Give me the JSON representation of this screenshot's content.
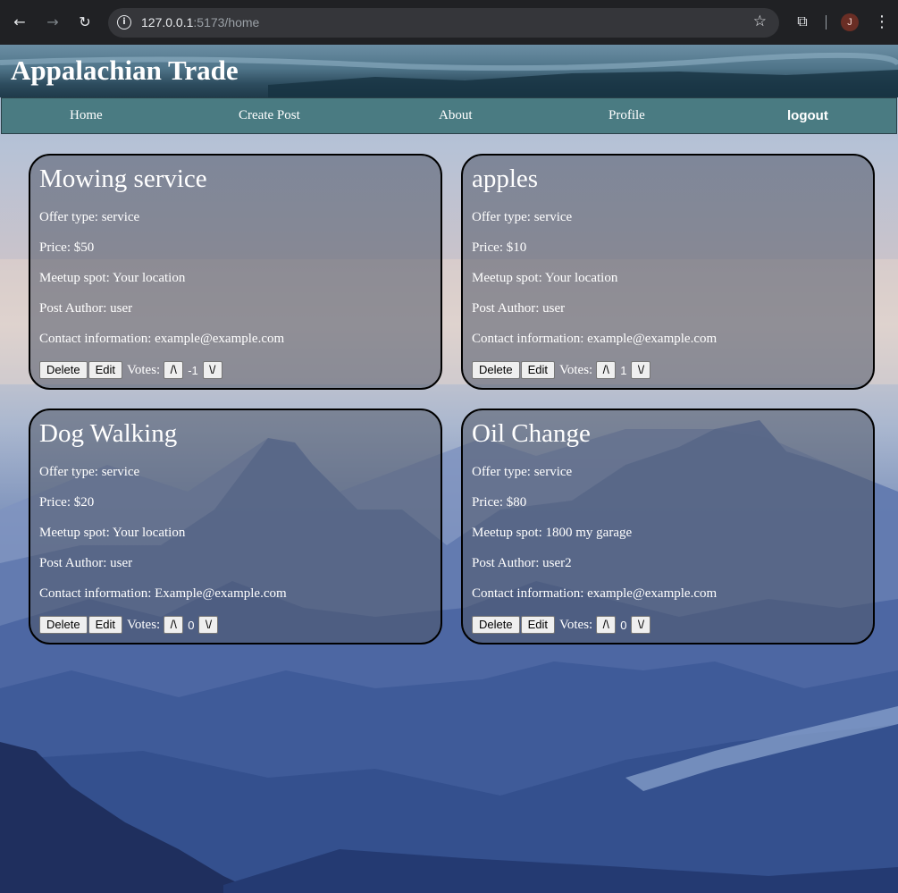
{
  "browser": {
    "url_host": "127.0.0.1",
    "url_rest": ":5173/home",
    "profile_initial": "J"
  },
  "site": {
    "title": "Appalachian Trade"
  },
  "nav": {
    "home": "Home",
    "create_post": "Create Post",
    "about": "About",
    "profile": "Profile",
    "logout": "logout"
  },
  "labels": {
    "delete": "Delete",
    "edit": "Edit",
    "votes": "Votes:",
    "upvote": "/\\",
    "downvote": "\\/"
  },
  "posts": [
    {
      "title": "Mowing service",
      "offer_type": "Offer type: service",
      "price": "Price: $50",
      "meetup": "Meetup spot: Your location",
      "author": "Post Author: user",
      "contact": "Contact information: example@example.com",
      "votes": "-1"
    },
    {
      "title": "apples",
      "offer_type": "Offer type: service",
      "price": "Price: $10",
      "meetup": "Meetup spot: Your location",
      "author": "Post Author: user",
      "contact": "Contact information: example@example.com",
      "votes": "1"
    },
    {
      "title": "Dog Walking",
      "offer_type": "Offer type: service",
      "price": "Price: $20",
      "meetup": "Meetup spot: Your location",
      "author": "Post Author: user",
      "contact": "Contact information: Example@example.com",
      "votes": "0"
    },
    {
      "title": "Oil Change",
      "offer_type": "Offer type: service",
      "price": "Price: $80",
      "meetup": "Meetup spot: 1800 my garage",
      "author": "Post Author: user2",
      "contact": "Contact information: example@example.com",
      "votes": "0"
    }
  ]
}
